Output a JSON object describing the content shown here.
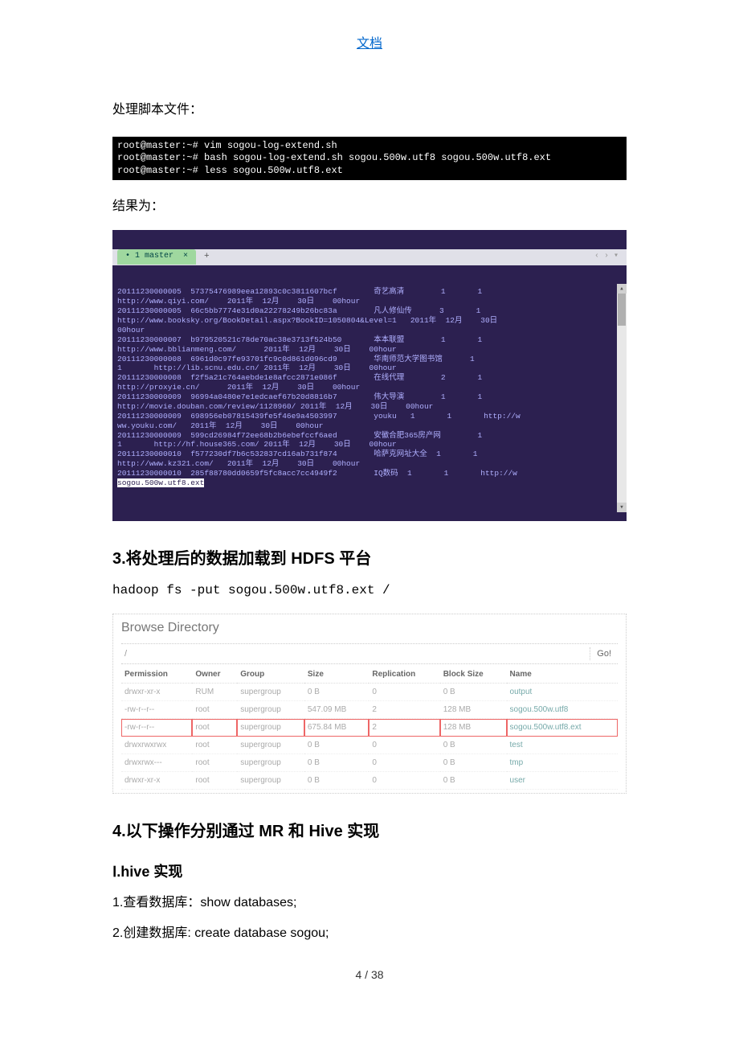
{
  "header_link": "文档",
  "para1": "处理脚本文件：",
  "terminal1_lines": [
    "root@master:~# vim sogou-log-extend.sh",
    "root@master:~# bash sogou-log-extend.sh sogou.500w.utf8 sogou.500w.utf8.ext",
    "root@master:~# less sogou.500w.utf8.ext"
  ],
  "para2": "结果为：",
  "terminal2": {
    "tab_label": "• 1 master  ×",
    "tab_plus": "+",
    "content": "20111230000005  57375476989eea12893c0c3811607bcf        奇艺高清        1       1\nhttp://www.qiyi.com/    2011年  12月    30日    00hour\n20111230000005  66c5bb7774e31d0a22278249b26bc83a        凡人修仙传      3       1\nhttp://www.booksky.org/BookDetail.aspx?BookID=1050804&Level=1   2011年  12月    30日\n00hour\n20111230000007  b979520521c78de70ac38e3713f524b50       本本联盟        1       1\nhttp://www.bblianmeng.com/      2011年  12月    30日    00hour\n20111230000008  6961d0c97fe93701fc9c0d861d096cd9        华南师范大学图书馆      1\n1       http://lib.scnu.edu.cn/ 2011年  12月    30日    00hour\n20111230000008  f2f5a21c764aebde1e8afcc2871e086f        在线代理        2       1\nhttp://proxyie.cn/      2011年  12月    30日    00hour\n20111230000009  96994a0480e7e1edcaef67b20d8816b7        伟大导演        1       1\nhttp://movie.douban.com/review/1128960/ 2011年  12月    30日    00hour\n20111230000009  698956eb07815439fe5f46e9a4503997        youku   1       1       http://w\nww.youku.com/   2011年  12月    30日    00hour\n20111230000009  599cd26984f72ee68b2b6ebefccf6aed        安徽合肥365房产网        1\n1       http://hf.house365.com/ 2011年  12月    30日    00hour\n20111230000010  f577230df7b6c532837cd16ab731f874        哈萨克网址大全  1       1\nhttp://www.kz321.com/   2011年  12月    30日    00hour\n20111230000010  285f88780dd0659f5fc8acc7cc4949f2        IQ数码  1       1       http://w",
    "cursor_line": "sogou.500w.utf8.ext"
  },
  "section3_title": "3.将处理后的数据加载到 HDFS 平台",
  "cmd3": "hadoop fs -put sogou.500w.utf8.ext /",
  "hdfs": {
    "title": "Browse Directory",
    "path": "/",
    "go": "Go!",
    "headers": [
      "Permission",
      "Owner",
      "Group",
      "Size",
      "Replication",
      "Block Size",
      "Name"
    ],
    "rows": [
      {
        "perm": "drwxr-xr-x",
        "owner": "RUM",
        "group": "supergroup",
        "size": "0 B",
        "rep": "0",
        "block": "0 B",
        "name": "output",
        "hl": false
      },
      {
        "perm": "-rw-r--r--",
        "owner": "root",
        "group": "supergroup",
        "size": "547.09 MB",
        "rep": "2",
        "block": "128 MB",
        "name": "sogou.500w.utf8",
        "hl": false
      },
      {
        "perm": "-rw-r--r--",
        "owner": "root",
        "group": "supergroup",
        "size": "675.84 MB",
        "rep": "2",
        "block": "128 MB",
        "name": "sogou.500w.utf8.ext",
        "hl": true
      },
      {
        "perm": "drwxrwxrwx",
        "owner": "root",
        "group": "supergroup",
        "size": "0 B",
        "rep": "0",
        "block": "0 B",
        "name": "test",
        "hl": false
      },
      {
        "perm": "drwxrwx---",
        "owner": "root",
        "group": "supergroup",
        "size": "0 B",
        "rep": "0",
        "block": "0 B",
        "name": "tmp",
        "hl": false
      },
      {
        "perm": "drwxr-xr-x",
        "owner": "root",
        "group": "supergroup",
        "size": "0 B",
        "rep": "0",
        "block": "0 B",
        "name": "user",
        "hl": false
      }
    ]
  },
  "section4_title": "4.以下操作分别通过 MR 和 Hive 实现",
  "sub_hive_title": "Ⅰ.hive 实现",
  "hive_step1": "1.查看数据库：show databases;",
  "hive_step2": "2.创建数据库: create database sogou;",
  "page_num": "4 / 38"
}
